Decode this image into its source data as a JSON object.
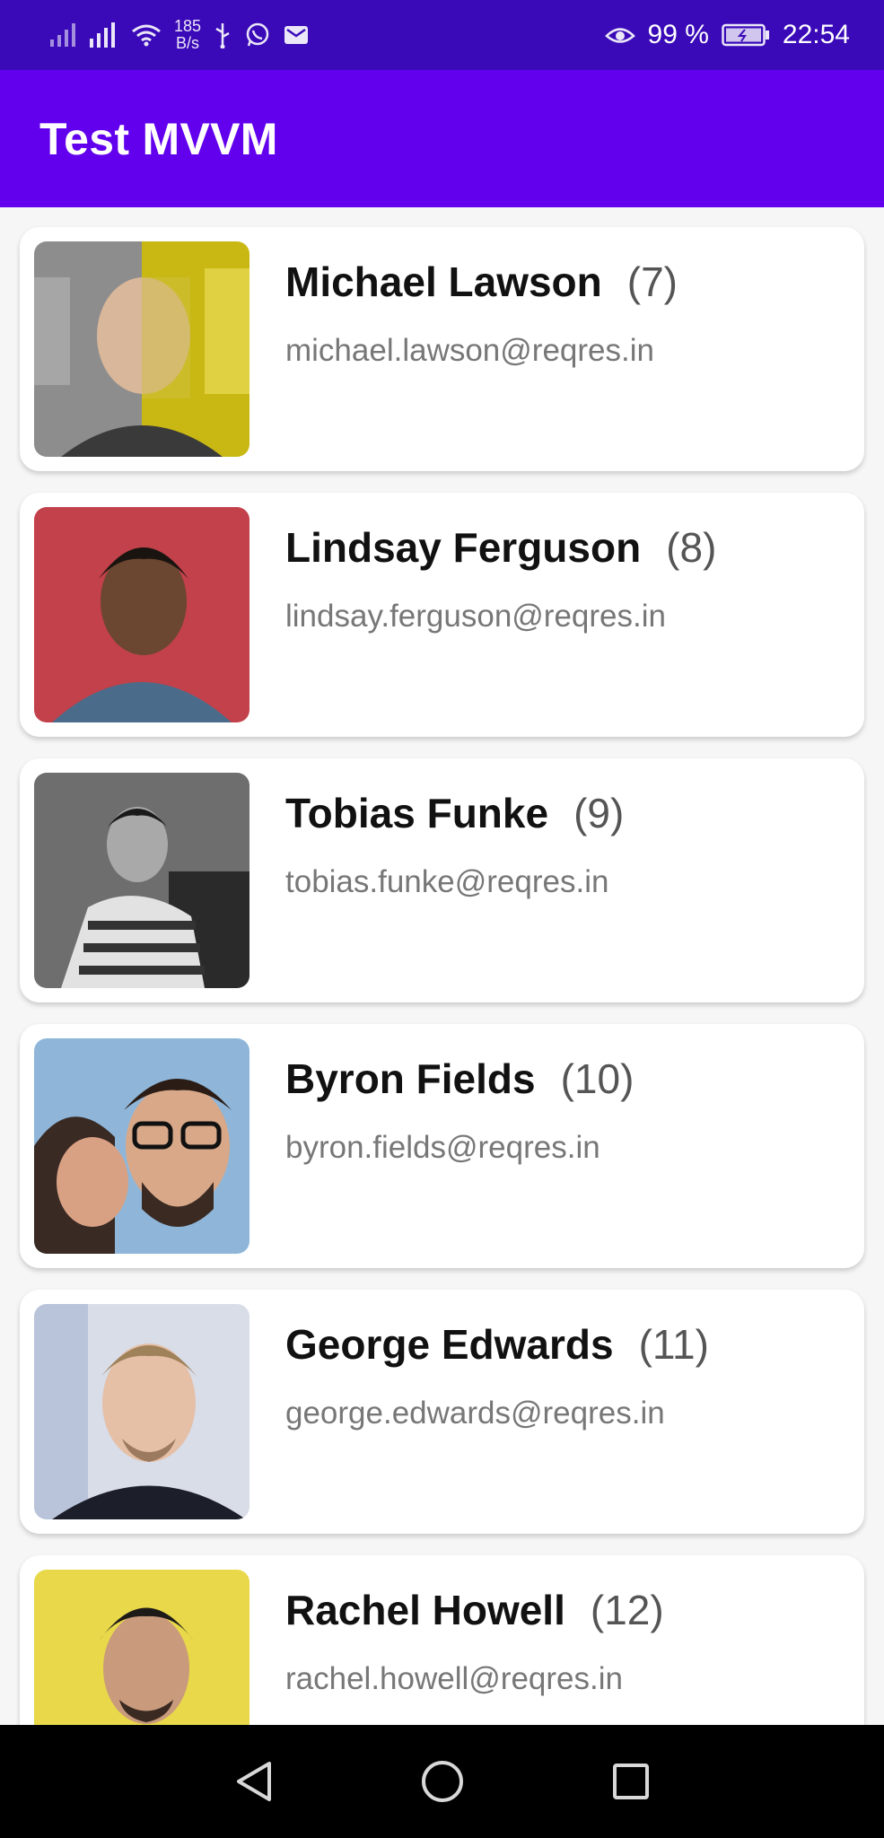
{
  "status_bar": {
    "net_speed_value": "185",
    "net_speed_unit": "B/s",
    "battery": "99 %",
    "time": "22:54",
    "icons": [
      "signal-icon",
      "signal-icon",
      "wifi-icon",
      "usb-icon",
      "whatsapp-icon",
      "mail-icon",
      "eye-icon",
      "battery-icon"
    ]
  },
  "app_bar": {
    "title": "Test MVVM"
  },
  "users": [
    {
      "name": "Michael Lawson",
      "id": "(7)",
      "email": "michael.lawson@reqres.in"
    },
    {
      "name": "Lindsay Ferguson",
      "id": "(8)",
      "email": "lindsay.ferguson@reqres.in"
    },
    {
      "name": "Tobias Funke",
      "id": "(9)",
      "email": "tobias.funke@reqres.in"
    },
    {
      "name": "Byron Fields",
      "id": "(10)",
      "email": "byron.fields@reqres.in"
    },
    {
      "name": "George Edwards",
      "id": "(11)",
      "email": "george.edwards@reqres.in"
    },
    {
      "name": "Rachel Howell",
      "id": "(12)",
      "email": "rachel.howell@reqres.in"
    }
  ],
  "nav_bar": {
    "icons": [
      "back-icon",
      "home-icon",
      "recents-icon"
    ]
  },
  "colors": {
    "status_bar": "#3a0ab8",
    "app_bar": "#6200ee",
    "background": "#f6f6f6",
    "card": "#ffffff"
  }
}
